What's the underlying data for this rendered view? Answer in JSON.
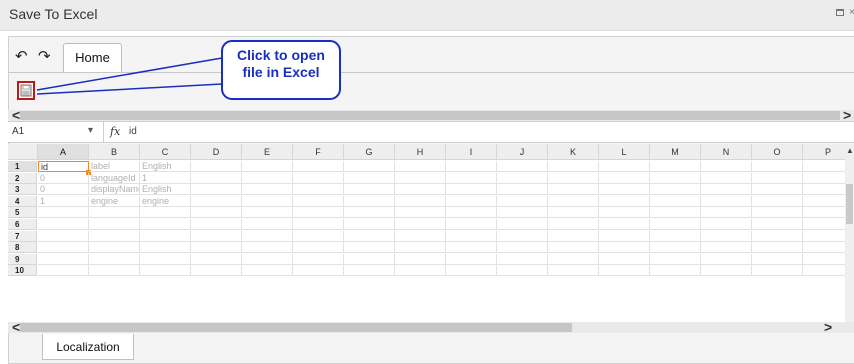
{
  "window": {
    "title": "Save To Excel"
  },
  "ribbon": {
    "undo_icon": "undo-icon",
    "redo_icon": "redo-icon",
    "tab_label": "Home"
  },
  "toolbar": {
    "save_icon": "save-to-excel-icon"
  },
  "callout": {
    "line1": "Click to open",
    "line2": "file in Excel",
    "color": "#1a2fc0"
  },
  "formula_bar": {
    "cell_ref": "A1",
    "fx_label": "fx",
    "value": "id"
  },
  "spreadsheet": {
    "columns": [
      "A",
      "B",
      "C",
      "D",
      "E",
      "F",
      "G",
      "H",
      "I",
      "J",
      "K",
      "L",
      "M",
      "N",
      "O",
      "P"
    ],
    "rows": [
      "1",
      "2",
      "3",
      "4",
      "5",
      "6",
      "7",
      "8",
      "9",
      "10"
    ],
    "cells": [
      [
        "id",
        "label",
        "English"
      ],
      [
        "0",
        "languageId",
        "1"
      ],
      [
        "0",
        "displayName",
        "English"
      ],
      [
        "1",
        "engine",
        "engine"
      ]
    ],
    "active_cell": "A1",
    "accent_color": "#f08a24"
  },
  "sheet_tabs": [
    "Localization"
  ]
}
